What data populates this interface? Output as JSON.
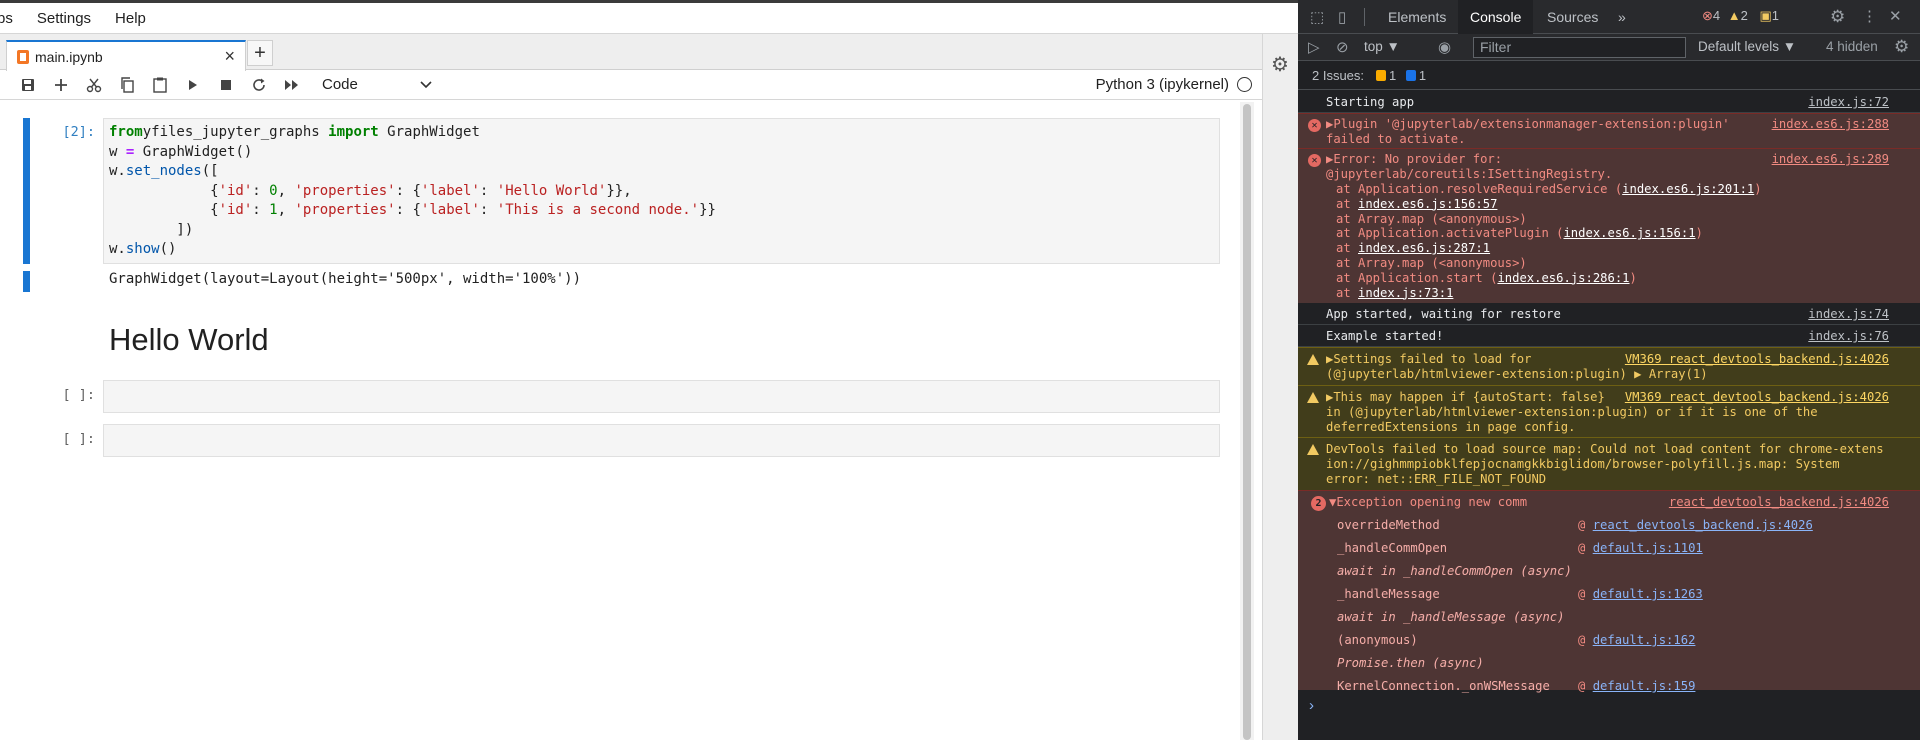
{
  "menubar": {
    "items": [
      "ps",
      "Settings",
      "Help"
    ]
  },
  "tab": {
    "label": "main.ipynb",
    "close": "×",
    "add": "+"
  },
  "toolbar": {
    "cell_type": "Code",
    "kernel": "Python 3 (ipykernel)"
  },
  "cells": [
    {
      "prompt": "[2]:",
      "code_lines": [
        [
          [
            "kw",
            "from"
          ],
          [
            "",
            "yfiles_jupyter_graphs "
          ],
          [
            "kw",
            "import"
          ],
          [
            "",
            " GraphWidget"
          ]
        ],
        [
          [
            "",
            "w "
          ],
          [
            "op",
            "="
          ],
          [
            "",
            " GraphWidget()"
          ]
        ],
        [
          [
            "",
            "w."
          ],
          [
            "fn",
            "set_nodes"
          ],
          [
            "",
            "(["
          ]
        ],
        [
          [
            "",
            "            {"
          ],
          [
            "str",
            "'id'"
          ],
          [
            "",
            ": "
          ],
          [
            "num",
            "0"
          ],
          [
            "",
            ", "
          ],
          [
            "str",
            "'properties'"
          ],
          [
            "",
            ": {"
          ],
          [
            "str",
            "'label'"
          ],
          [
            "",
            ": "
          ],
          [
            "str",
            "'Hello World'"
          ],
          [
            "",
            "}},"
          ]
        ],
        [
          [
            "",
            "            {"
          ],
          [
            "str",
            "'id'"
          ],
          [
            "",
            ": "
          ],
          [
            "num",
            "1"
          ],
          [
            "",
            ", "
          ],
          [
            "str",
            "'properties'"
          ],
          [
            "",
            ": {"
          ],
          [
            "str",
            "'label'"
          ],
          [
            "",
            ": "
          ],
          [
            "str",
            "'This is a second node.'"
          ],
          [
            "",
            "}}"
          ]
        ],
        [
          [
            "",
            "        ])"
          ]
        ],
        [
          [
            "",
            "w."
          ],
          [
            "fn",
            "show"
          ],
          [
            "",
            "()"
          ]
        ]
      ]
    },
    {
      "output_text": "GraphWidget(layout=Layout(height='500px', width='100%'))",
      "heading": "Hello World"
    },
    {
      "prompt": "[ ]:"
    },
    {
      "prompt": "[ ]:"
    }
  ],
  "devtools": {
    "tabs": [
      "Elements",
      "Console",
      "Sources",
      "»"
    ],
    "counts": {
      "errors": "4",
      "warnings": "2",
      "issues": "1"
    },
    "context": "top ▼",
    "filter_placeholder": "Filter",
    "levels": "Default levels ▼",
    "hidden": "4 hidden",
    "issues_label": "2 Issues:",
    "issues_warn": "1",
    "issues_info": "1",
    "messages": {
      "m1": {
        "text": "Starting app",
        "src": "index.js:72"
      },
      "m2": {
        "text": "▶Plugin '@jupyterlab/extensionmanager-extension:plugin'\nfailed to activate.",
        "src": "index.es6.js:288"
      },
      "m3": {
        "text": "▶Error: No provider for:\n@jupyterlab/coreutils:ISettingRegistry.",
        "src": "index.es6.js:289",
        "stack": [
          [
            "at Application.resolveRequiredService (",
            "index.es6.js:201:1",
            ")"
          ],
          [
            "at ",
            "index.es6.js:156:57",
            ""
          ],
          [
            "at Array.map (<anonymous>)",
            "",
            ""
          ],
          [
            "at Application.activatePlugin (",
            "index.es6.js:156:1",
            ")"
          ],
          [
            "at ",
            "index.es6.js:287:1",
            ""
          ],
          [
            "at Array.map (<anonymous>)",
            "",
            ""
          ],
          [
            "at Application.start (",
            "index.es6.js:286:1",
            ")"
          ],
          [
            "at ",
            "index.js:73:1",
            ""
          ]
        ]
      },
      "m4": {
        "text": "App started, waiting for restore",
        "src": "index.js:74"
      },
      "m5": {
        "text": "Example started!",
        "src": "index.js:76"
      },
      "m6": {
        "text": "▶Settings failed to load for\n(@jupyterlab/htmlviewer-extension:plugin) ▶ Array(1)",
        "src": "VM369 react_devtools_backend.js:4026"
      },
      "m7": {
        "text": "▶This may happen if {autoStart: false}\nin (@jupyterlab/htmlviewer-extension:plugin) or if it is one of the\ndeferredExtensions in page config.",
        "src": "VM369 react_devtools_backend.js:4026"
      },
      "m8": {
        "text": "DevTools failed to load source map: Could not load content for chrome-extens\nion://gighmmpiobklfepjocnamgkkbiglidom/browser-polyfill.js.map: System\nerror: net::ERR_FILE_NOT_FOUND"
      },
      "m9": {
        "count": "2",
        "text": "▼Exception opening new comm",
        "src": "react_devtools_backend.js:4026",
        "frames": [
          {
            "name": "overrideMethod",
            "loc": "react_devtools_backend.js:4026"
          },
          {
            "name": "_handleCommOpen",
            "loc": "default.js:1101"
          },
          {
            "async": "await in _handleCommOpen (async)"
          },
          {
            "name": "_handleMessage",
            "loc": "default.js:1263"
          },
          {
            "async": "await in _handleMessage (async)"
          },
          {
            "name": "(anonymous)",
            "loc": "default.js:162"
          },
          {
            "async": "Promise.then (async)"
          },
          {
            "name": "KernelConnection._onWSMessage",
            "loc": "default.js:159"
          }
        ]
      }
    },
    "prompt_caret": "›"
  }
}
